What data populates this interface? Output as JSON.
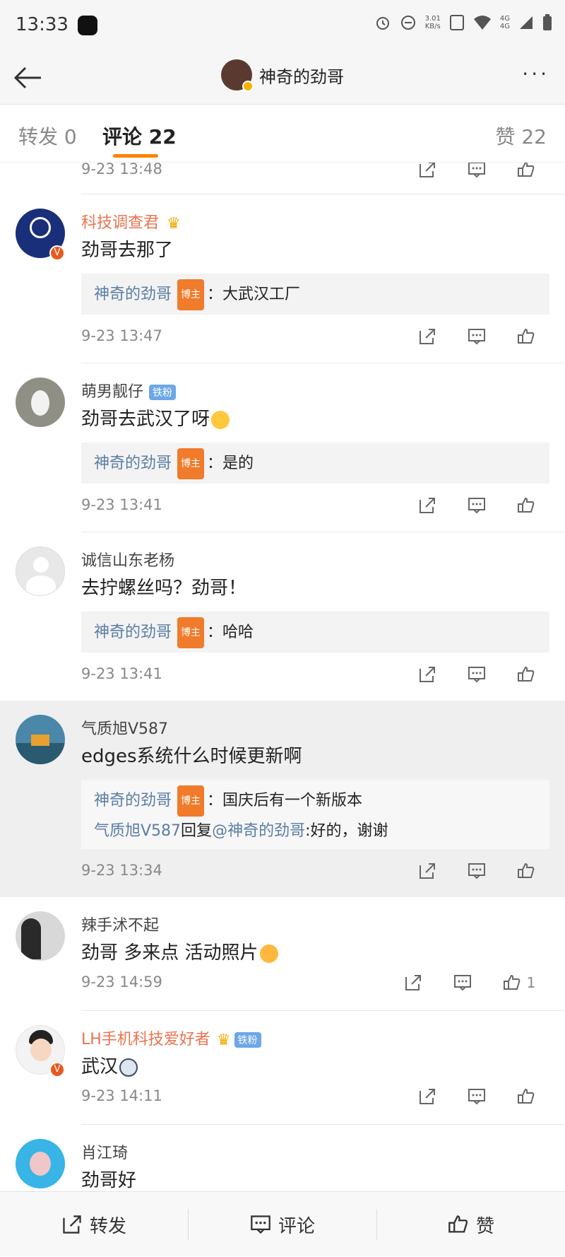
{
  "status": {
    "time": "13:33",
    "net_speed": "3.01",
    "net_unit": "KB/s",
    "net_type_1": "4G",
    "net_type_2": "4G"
  },
  "nav": {
    "title": "神奇的劲哥",
    "more": "···"
  },
  "tabs": {
    "repost": "转发 0",
    "comment": "评论 22",
    "like": "赞 22"
  },
  "top_date": "9-23 13:48",
  "comments": [
    {
      "name": "科技调查君",
      "name_color": "orange",
      "badge": "crown",
      "text": "劲哥去那了",
      "replies": [
        {
          "author": "神奇的劲哥",
          "owner": "博主",
          "text": "：大武汉工厂"
        }
      ],
      "date": "9-23 13:47"
    },
    {
      "name": "萌男靓仔",
      "badge": "fan",
      "badge_text": "铁粉",
      "text": "劲哥去武汉了呀",
      "replies": [
        {
          "author": "神奇的劲哥",
          "owner": "博主",
          "text": "：是的"
        }
      ],
      "date": "9-23 13:41"
    },
    {
      "name": "诚信山东老杨",
      "text": "去拧螺丝吗？劲哥！",
      "replies": [
        {
          "author": "神奇的劲哥",
          "owner": "博主",
          "text": "：哈哈"
        }
      ],
      "date": "9-23 13:41"
    },
    {
      "name": "气质旭V587",
      "text": "edges系统什么时候更新啊",
      "replies": [
        {
          "author": "神奇的劲哥",
          "owner": "博主",
          "text": "：国庆后有一个新版本"
        },
        {
          "author": "气质旭V587",
          "mid": "回复",
          "mention": "@神奇的劲哥",
          "text": ":好的，谢谢"
        }
      ],
      "date": "9-23 13:34"
    },
    {
      "name": "辣手沭不起",
      "text": "劲哥 多来点 活动照片",
      "date": "9-23 14:59",
      "like_count": "1"
    },
    {
      "name": "LH手机科技爱好者",
      "name_color": "orange",
      "badge": "fan",
      "badge_text": "铁粉",
      "text": "武汉",
      "date": "9-23 14:11"
    },
    {
      "name": "肖江琦",
      "text": "劲哥好"
    }
  ],
  "bottom": {
    "repost": "转发",
    "comment": "评论",
    "like": "赞"
  },
  "colors": {
    "accent": "#ff8200",
    "link": "#5b7da5",
    "owner_tag": "#f07b2a",
    "fan_tag": "#6ca7e6"
  }
}
